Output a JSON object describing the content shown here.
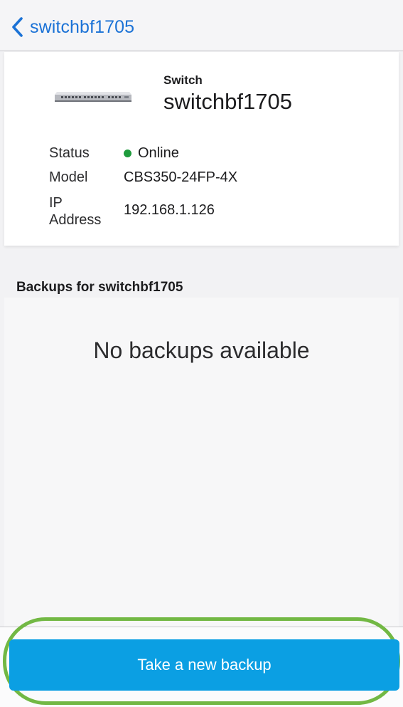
{
  "nav": {
    "back_label": "switchbf1705",
    "back_icon": "chevron-left-icon",
    "accent_color": "#1b72d6"
  },
  "device": {
    "type": "Switch",
    "name": "switchbf1705",
    "image_icon": "network-switch-icon",
    "info": {
      "status_label": "Status",
      "status_value": "Online",
      "status_color": "#1e9b3c",
      "model_label": "Model",
      "model_value": "CBS350-24FP-4X",
      "ip_label_line1": "IP",
      "ip_label_line2": "Address",
      "ip_value": "192.168.1.126"
    }
  },
  "backups": {
    "section_title": "Backups for switchbf1705",
    "empty_message": "No backups available"
  },
  "footer": {
    "button_label": "Take a new backup",
    "button_color": "#0b9fe3",
    "highlight_color": "#72b844"
  }
}
